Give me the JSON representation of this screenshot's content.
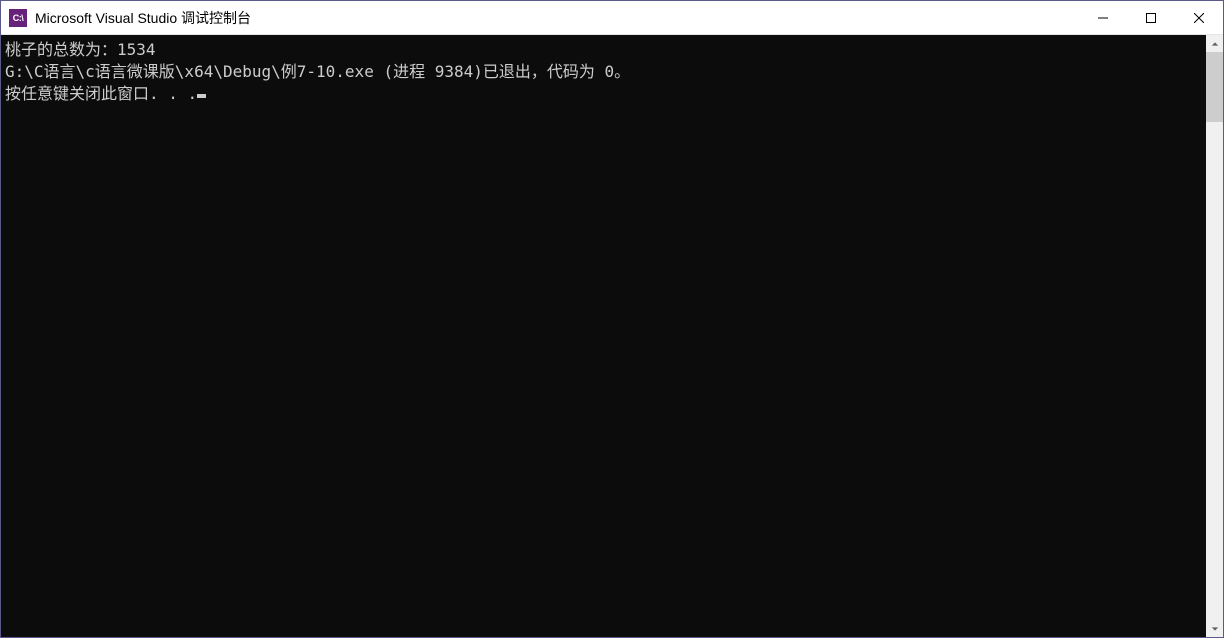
{
  "titlebar": {
    "app_icon_text": "C:\\",
    "title": "Microsoft Visual Studio 调试控制台"
  },
  "console": {
    "lines": [
      "桃子的总数为：1534",
      "G:\\C语言\\c语言微课版\\x64\\Debug\\例7-10.exe (进程 9384)已退出，代码为 0。",
      "按任意键关闭此窗口. . ."
    ]
  }
}
